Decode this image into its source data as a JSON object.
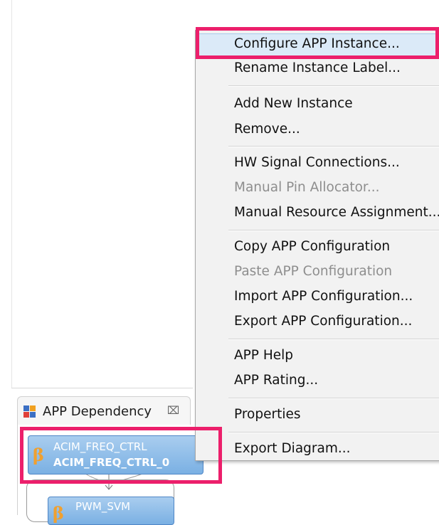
{
  "view": {
    "title": "APP Dependency",
    "close_glyph": "⌧",
    "icon": "app-dependency-icon"
  },
  "nodes": [
    {
      "name": "ACIM_FREQ_CTRL",
      "instance": "ACIM_FREQ_CTRL_0",
      "badge": "β"
    },
    {
      "name": "PWM_SVM",
      "badge": "β"
    }
  ],
  "context_menu": {
    "items": [
      {
        "label": "Configure APP Instance...",
        "enabled": true
      },
      {
        "label": "Rename Instance Label...",
        "enabled": true
      },
      {
        "label": "Add New Instance",
        "enabled": true
      },
      {
        "label": "Remove...",
        "enabled": true
      },
      {
        "label": "HW Signal Connections...",
        "enabled": true
      },
      {
        "label": "Manual Pin Allocator...",
        "enabled": false
      },
      {
        "label": "Manual Resource Assignment...",
        "enabled": true
      },
      {
        "label": "Copy APP Configuration",
        "enabled": true
      },
      {
        "label": "Paste APP Configuration",
        "enabled": false
      },
      {
        "label": "Import APP Configuration...",
        "enabled": true
      },
      {
        "label": "Export APP Configuration...",
        "enabled": true
      },
      {
        "label": "APP Help",
        "enabled": true
      },
      {
        "label": "APP Rating...",
        "enabled": true
      },
      {
        "label": "Properties",
        "enabled": true
      },
      {
        "label": "Export Diagram...",
        "enabled": true
      }
    ]
  },
  "colors": {
    "annotation": "#ec1f6b",
    "node_fill": "#8fbfe9",
    "menu_highlight": "#dbeaf8",
    "disabled_text": "#8e8e8e"
  }
}
